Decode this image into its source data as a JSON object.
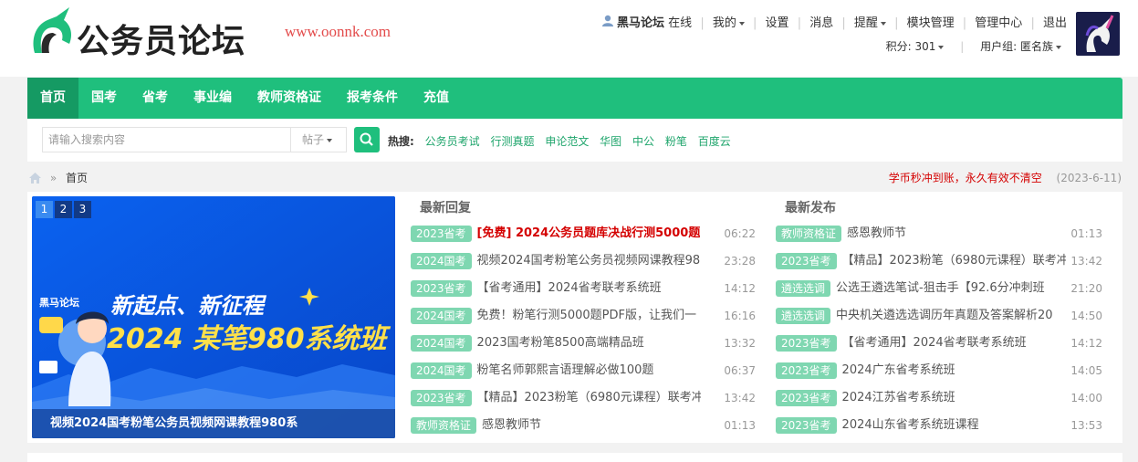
{
  "site": {
    "logo_text": "公务员论坛",
    "url_text": "www.oonnk.com"
  },
  "userbar": {
    "username": "黑马论坛",
    "status": "在线",
    "links": [
      "我的",
      "设置",
      "消息",
      "提醒",
      "模块管理",
      "管理中心",
      "退出"
    ],
    "points_label": "积分: 301",
    "group_label": "用户组: 匿名族"
  },
  "nav": {
    "items": [
      "首页",
      "国考",
      "省考",
      "事业编",
      "教师资格证",
      "报考条件",
      "充值"
    ]
  },
  "search": {
    "placeholder": "请输入搜索内容",
    "type": "帖子",
    "hot_label": "热搜:",
    "hot_terms": [
      "公务员考试",
      "行测真题",
      "申论范文",
      "华图",
      "中公",
      "粉笔",
      "百度云"
    ]
  },
  "breadcrumb": {
    "current": "首页"
  },
  "notice": {
    "text": "学币秒冲到账，永久有效不清空",
    "date": "(2023-6-11)"
  },
  "slider": {
    "pages": [
      "1",
      "2",
      "3"
    ],
    "banner_brand": "黑马论坛",
    "banner_line1": "新起点、新征程",
    "banner_line2": "2024 某笔980系统班",
    "caption": "视频2024国考粉笔公务员视频网课教程980系"
  },
  "latest_replies": {
    "heading": "最新回复",
    "rows": [
      {
        "tag": "2023省考",
        "title": "[免费] 2024公务员题库决战行测5000题",
        "time": "06:22",
        "highlight": true
      },
      {
        "tag": "2024国考",
        "title": "视频2024国考粉笔公务员视频网课教程98",
        "time": "23:28"
      },
      {
        "tag": "2023省考",
        "title": "【省考通用】2024省考联考系统班",
        "time": "14:12"
      },
      {
        "tag": "2024国考",
        "title": "免费！粉笔行测5000题PDF版，让我们一",
        "time": "16:16"
      },
      {
        "tag": "2024国考",
        "title": "2023国考粉笔8500高端精品班",
        "time": "13:32"
      },
      {
        "tag": "2024国考",
        "title": "粉笔名师郭熙言语理解必做100题",
        "time": "06:37"
      },
      {
        "tag": "2023省考",
        "title": "【精品】2023粉笔（6980元课程）联考冲",
        "time": "13:42"
      },
      {
        "tag": "教师资格证",
        "title": "感恩教师节",
        "time": "01:13"
      }
    ]
  },
  "latest_posts": {
    "heading": "最新发布",
    "rows": [
      {
        "tag": "教师资格证",
        "title": "感恩教师节",
        "time": "01:13"
      },
      {
        "tag": "2023省考",
        "title": "【精品】2023粉笔（6980元课程）联考冲",
        "time": "13:42"
      },
      {
        "tag": "遴选选调",
        "title": "公选王遴选笔试-狙击手【92.6分冲刺班",
        "time": "21:20"
      },
      {
        "tag": "遴选选调",
        "title": "中央机关遴选选调历年真题及答案解析20",
        "time": "14:50"
      },
      {
        "tag": "2023省考",
        "title": "【省考通用】2024省考联考系统班",
        "time": "14:12"
      },
      {
        "tag": "2023省考",
        "title": "2024广东省考系统班",
        "time": "14:05"
      },
      {
        "tag": "2023省考",
        "title": "2024江苏省考系统班",
        "time": "14:00"
      },
      {
        "tag": "2023省考",
        "title": "2024山东省考系统班课程",
        "time": "13:53"
      }
    ]
  },
  "colors": {
    "accent": "#1fbf7d",
    "accent_dark": "#159a63",
    "tag_bg": "#7fd7b1",
    "alert": "#d40000",
    "url": "#e34b4b"
  }
}
